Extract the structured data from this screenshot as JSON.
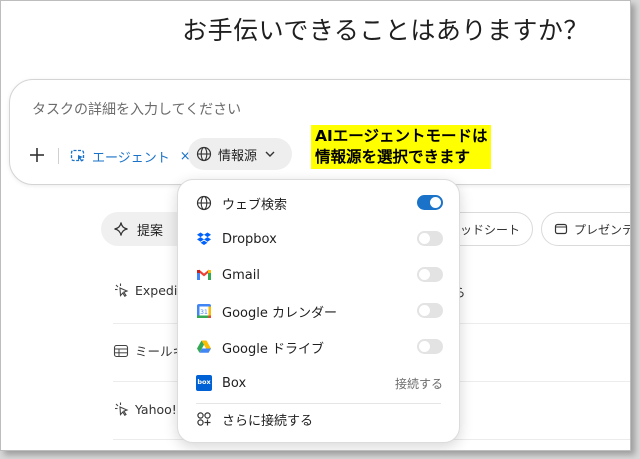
{
  "heading": "お手伝いできることはありますか？",
  "composer": {
    "placeholder": "タスクの詳細を入力してください",
    "agent_chip_label": "エージェント",
    "agent_chip_remove": "×",
    "sources_label": "情報源"
  },
  "callout": {
    "line1": "AIエージェントモードは",
    "line2": "情報源を選択できます"
  },
  "chips": {
    "suggest_label": "提案",
    "sheet_label": "プレッドシート",
    "slides_label": "プレゼンテ"
  },
  "tasks": [
    {
      "label": "Expedi",
      "tail": "ら"
    },
    {
      "label": "ミールキ"
    },
    {
      "label": "Yahoo!"
    }
  ],
  "sources_menu": {
    "items": [
      {
        "label": "ウェブ検索",
        "icon": "globe-icon",
        "enabled": true
      },
      {
        "label": "Dropbox",
        "icon": "dropbox-icon",
        "enabled": false
      },
      {
        "label": "Gmail",
        "icon": "gmail-icon",
        "enabled": false
      },
      {
        "label": "Google カレンダー",
        "icon": "google-calendar-icon",
        "enabled": false
      },
      {
        "label": "Google ドライブ",
        "icon": "google-drive-icon",
        "enabled": false
      },
      {
        "label": "Box",
        "icon": "box-icon",
        "action": "接続する"
      }
    ],
    "more_label": "さらに接続する",
    "box_icon_text": "box"
  },
  "colors": {
    "accent": "#1a73c8",
    "callout_bg": "#ffff00",
    "toggle_off": "#e3e3e3"
  }
}
